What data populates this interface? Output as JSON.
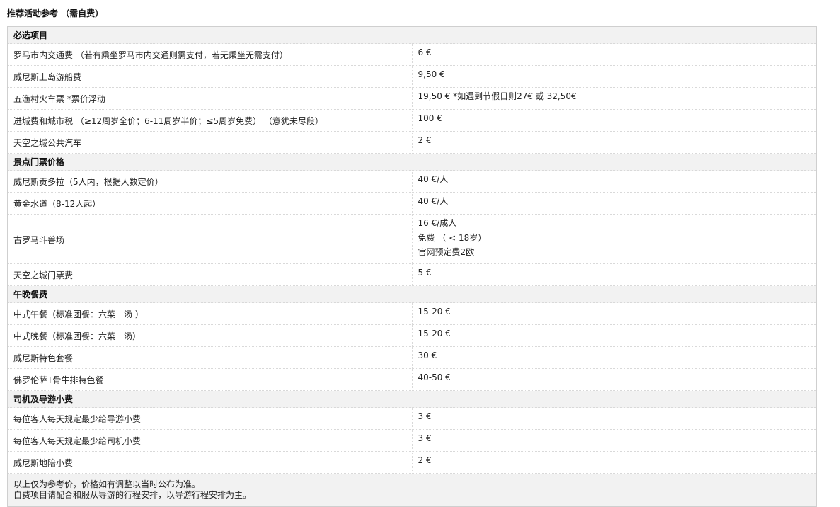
{
  "title": "推荐活动参考 （需自费）",
  "sections": [
    {
      "heading": "必选项目",
      "rows": [
        {
          "item": "罗马市内交通费 （若有乘坐罗马市内交通则需支付，若无乘坐无需支付）",
          "price": "6 €"
        },
        {
          "item": "威尼斯上岛游船费",
          "price": "9,50 €"
        },
        {
          "item": "五渔村火车票 *票价浮动",
          "price": "19,50 € *如遇到节假日则27€ 或 32,50€"
        },
        {
          "item": "进城费和城市税 （≥12周岁全价；6-11周岁半价；≤5周岁免费） （意犹未尽段）",
          "price": "100 €"
        },
        {
          "item": "天空之城公共汽车",
          "price": "2 €"
        }
      ]
    },
    {
      "heading": "景点门票价格",
      "rows": [
        {
          "item": "威尼斯贡多拉（5人内，根据人数定价）",
          "price": "40 €/人"
        },
        {
          "item": "黄金水道（8-12人起）",
          "price": "40 €/人"
        },
        {
          "item": "天空之城门票费",
          "price": "5 €"
        }
      ],
      "colosseum": {
        "item": "古罗马斗兽场",
        "price_lines": [
          "16 €/成人",
          "免费 （ < 18岁）",
          "官网预定费2欧"
        ]
      }
    },
    {
      "heading": "午晚餐费",
      "rows": [
        {
          "item": "中式午餐（标准团餐：六菜一汤 ）",
          "price": "15-20 €"
        },
        {
          "item": "中式晚餐（标准团餐：六菜一汤）",
          "price": "15-20 €"
        },
        {
          "item": "威尼斯特色套餐",
          "price": "30 €"
        },
        {
          "item": "佛罗伦萨T骨牛排特色餐",
          "price": "40-50 €"
        }
      ]
    },
    {
      "heading": "司机及导游小费",
      "rows": [
        {
          "item": "每位客人每天规定最少给导游小费",
          "price": "3 €"
        },
        {
          "item": "每位客人每天规定最少给司机小费",
          "price": "3 €"
        },
        {
          "item": "威尼斯地陪小费",
          "price": "2 €"
        }
      ]
    }
  ],
  "footer": [
    "以上仅为参考价，价格如有调整以当时公布为准。",
    "自费项目请配合和服从导游的行程安排，以导游行程安排为主。"
  ]
}
